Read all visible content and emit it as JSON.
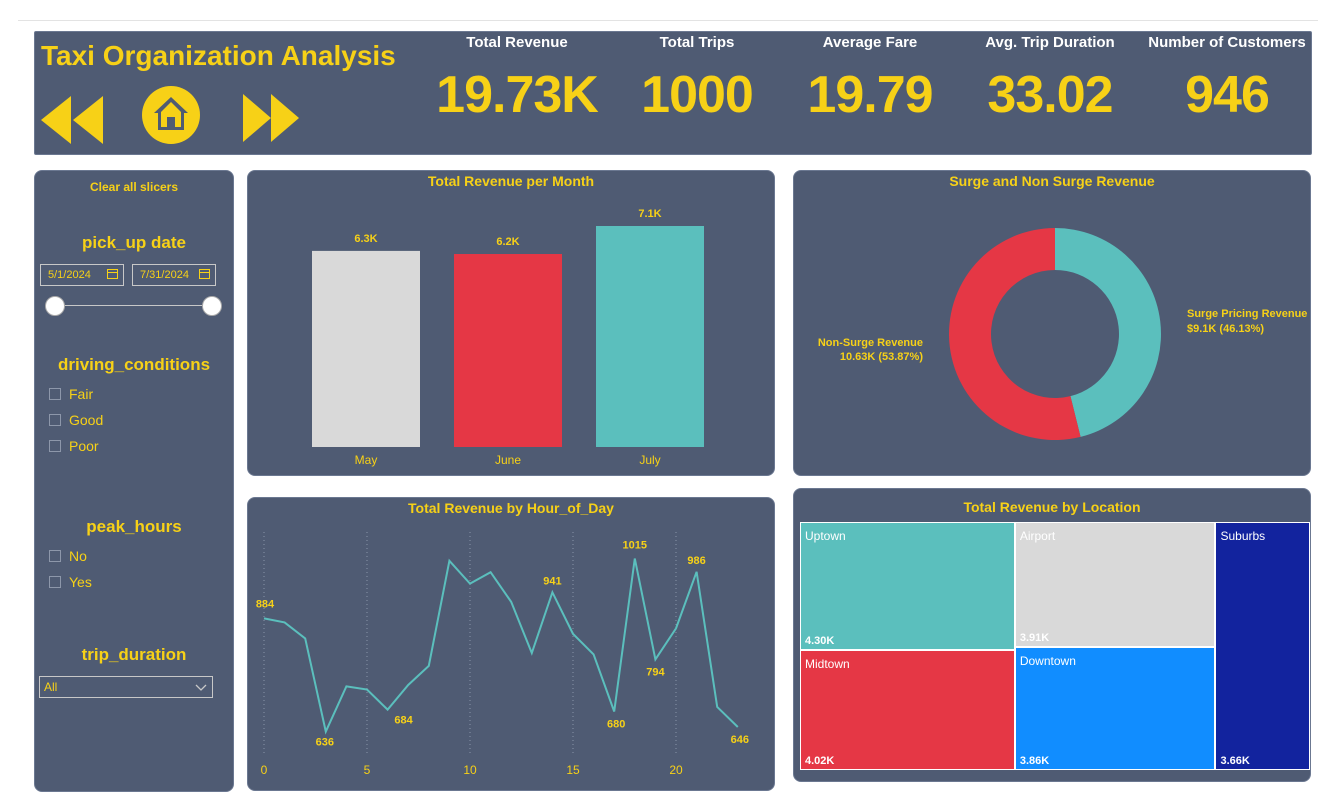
{
  "header": {
    "title": "Taxi Organization Analysis",
    "kpis": [
      {
        "label": "Total Revenue",
        "value": "19.73K"
      },
      {
        "label": "Total Trips",
        "value": "1000"
      },
      {
        "label": "Average Fare",
        "value": "19.79"
      },
      {
        "label": "Avg. Trip Duration",
        "value": "33.02"
      },
      {
        "label": "Number of Customers",
        "value": "946"
      }
    ]
  },
  "slicers": {
    "clear_label": "Clear all slicers",
    "pickup": {
      "title": "pick_up date",
      "start": "5/1/2024",
      "end": "7/31/2024"
    },
    "driving": {
      "title": "driving_conditions",
      "options": [
        "Fair",
        "Good",
        "Poor"
      ]
    },
    "peak": {
      "title": "peak_hours",
      "options": [
        "No",
        "Yes"
      ]
    },
    "trip": {
      "title": "trip_duration",
      "selected": "All"
    }
  },
  "colors": {
    "accent": "#f7d117",
    "panel": "#4f5b73",
    "teal": "#5bbfbd",
    "red": "#e53745",
    "grey": "#d9d9d9",
    "blue": "#118dff",
    "navy": "#12239e"
  },
  "chart_data": [
    {
      "type": "bar",
      "title": "Total Revenue per Month",
      "categories": [
        "May",
        "June",
        "July"
      ],
      "values": [
        6.3,
        6.2,
        7.1
      ],
      "labels": [
        "6.3K",
        "6.2K",
        "7.1K"
      ],
      "colors": [
        "#d9d9d9",
        "#e53745",
        "#5bbfbd"
      ],
      "ylim": [
        0,
        7.1
      ]
    },
    {
      "type": "pie",
      "title": "Surge and Non Surge Revenue",
      "slices": [
        {
          "name": "Surge Pricing Revenue",
          "value": 9.1,
          "pct": 46.13,
          "label": "$9.1K (46.13%)",
          "color": "#5bbfbd"
        },
        {
          "name": "Non-Surge Revenue",
          "value": 10.63,
          "pct": 53.87,
          "label": "10.63K (53.87%)",
          "color": "#e53745"
        }
      ]
    },
    {
      "type": "line",
      "title": "Total Revenue by Hour_of_Day",
      "x": [
        0,
        1,
        2,
        3,
        4,
        5,
        6,
        7,
        8,
        9,
        10,
        11,
        12,
        13,
        14,
        15,
        16,
        17,
        18,
        19,
        20,
        21,
        22,
        23
      ],
      "values": [
        884,
        875,
        840,
        636,
        735,
        728,
        684,
        738,
        780,
        1010,
        960,
        985,
        920,
        808,
        941,
        850,
        805,
        680,
        1015,
        794,
        862,
        986,
        690,
        646
      ],
      "data_labels": {
        "0": "884",
        "3": "636",
        "6": "684",
        "14": "941",
        "17": "680",
        "18": "1015",
        "19": "794",
        "21": "986",
        "23": "646"
      },
      "xticks": [
        0,
        5,
        10,
        15,
        20
      ],
      "ylim": [
        600,
        1060
      ],
      "color": "#5bbfbd"
    },
    {
      "type": "treemap",
      "title": "Total Revenue by Location",
      "items": [
        {
          "name": "Uptown",
          "value": 4.3,
          "label": "4.30K",
          "color": "#5bbfbd"
        },
        {
          "name": "Midtown",
          "value": 4.02,
          "label": "4.02K",
          "color": "#e53745"
        },
        {
          "name": "Airport",
          "value": 3.91,
          "label": "3.91K",
          "color": "#d9d9d9"
        },
        {
          "name": "Downtown",
          "value": 3.86,
          "label": "3.86K",
          "color": "#118dff"
        },
        {
          "name": "Suburbs",
          "value": 3.66,
          "label": "3.66K",
          "color": "#12239e"
        }
      ]
    }
  ]
}
